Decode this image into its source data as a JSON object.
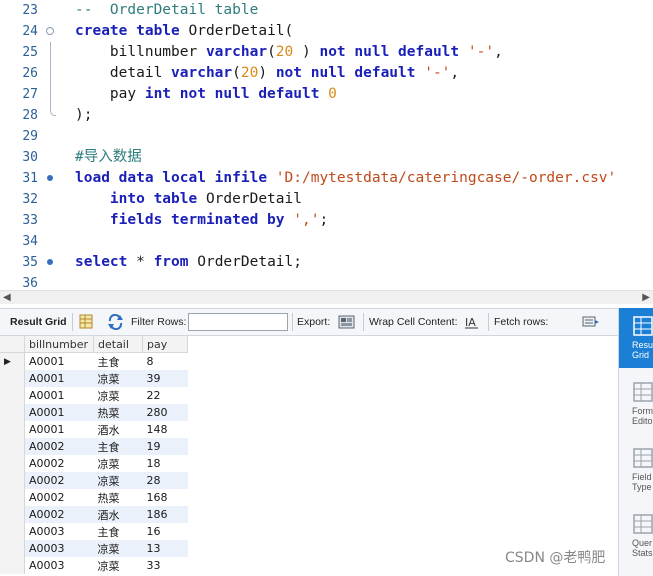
{
  "editor": {
    "lines": [
      {
        "n": "23",
        "parts": [
          [
            "cmt",
            "--  OrderDetail table"
          ]
        ]
      },
      {
        "n": "24",
        "fold": "start",
        "parts": [
          [
            "kw",
            "create table "
          ],
          [
            "",
            "OrderDetail("
          ]
        ]
      },
      {
        "n": "25",
        "fold": "mid",
        "parts": [
          [
            "",
            "    billnumber "
          ],
          [
            "kw",
            "varchar"
          ],
          [
            "",
            "("
          ],
          [
            "num",
            "20"
          ],
          [
            "",
            " ) "
          ],
          [
            "kw",
            "not null default "
          ],
          [
            "str",
            "'-'"
          ],
          [
            "",
            ","
          ]
        ]
      },
      {
        "n": "26",
        "fold": "mid",
        "parts": [
          [
            "",
            "    detail "
          ],
          [
            "kw",
            "varchar"
          ],
          [
            "",
            "("
          ],
          [
            "num",
            "20"
          ],
          [
            "",
            ") "
          ],
          [
            "kw",
            "not null default "
          ],
          [
            "str",
            "'-'"
          ],
          [
            "",
            ","
          ]
        ]
      },
      {
        "n": "27",
        "fold": "mid",
        "parts": [
          [
            "",
            "    pay "
          ],
          [
            "kw",
            "int not null default "
          ],
          [
            "num",
            "0"
          ]
        ]
      },
      {
        "n": "28",
        "fold": "end",
        "parts": [
          [
            "",
            ");"
          ]
        ]
      },
      {
        "n": "29",
        "parts": []
      },
      {
        "n": "30",
        "parts": [
          [
            "cmt",
            "#导入数据"
          ]
        ]
      },
      {
        "n": "31",
        "fold": "dot",
        "parts": [
          [
            "kw",
            "load data local infile "
          ],
          [
            "str",
            "'D:/mytestdata/cateringcase/-order.csv'"
          ]
        ]
      },
      {
        "n": "32",
        "parts": [
          [
            "",
            "    "
          ],
          [
            "kw",
            "into table "
          ],
          [
            "",
            "OrderDetail"
          ]
        ]
      },
      {
        "n": "33",
        "parts": [
          [
            "",
            "    "
          ],
          [
            "kw",
            "fields terminated by "
          ],
          [
            "str",
            "','"
          ],
          [
            "",
            ";"
          ]
        ]
      },
      {
        "n": "34",
        "parts": []
      },
      {
        "n": "35",
        "fold": "dot",
        "parts": [
          [
            "kw",
            "select "
          ],
          [
            "",
            "* "
          ],
          [
            "kw",
            "from "
          ],
          [
            "",
            "OrderDetail;"
          ]
        ]
      },
      {
        "n": "36",
        "parts": []
      }
    ]
  },
  "toolbar": {
    "result_grid": "Result Grid",
    "filter_rows": "Filter Rows:",
    "filter_value": "",
    "export": "Export:",
    "wrap": "Wrap Cell Content:",
    "fetch": "Fetch rows:"
  },
  "grid": {
    "columns": [
      "billnumber",
      "detail",
      "pay"
    ],
    "rows": [
      [
        "A0001",
        "主食",
        "8"
      ],
      [
        "A0001",
        "凉菜",
        "39"
      ],
      [
        "A0001",
        "凉菜",
        "22"
      ],
      [
        "A0001",
        "热菜",
        "280"
      ],
      [
        "A0001",
        "酒水",
        "148"
      ],
      [
        "A0002",
        "主食",
        "19"
      ],
      [
        "A0002",
        "凉菜",
        "18"
      ],
      [
        "A0002",
        "凉菜",
        "28"
      ],
      [
        "A0002",
        "热菜",
        "168"
      ],
      [
        "A0002",
        "酒水",
        "186"
      ],
      [
        "A0003",
        "主食",
        "16"
      ],
      [
        "A0003",
        "凉菜",
        "13"
      ],
      [
        "A0003",
        "凉菜",
        "33"
      ]
    ]
  },
  "sidepanel": {
    "items": [
      {
        "label": "Resul\nGrid",
        "icon": "result-grid-icon"
      },
      {
        "label": "Form\nEdito",
        "icon": "form-editor-icon"
      },
      {
        "label": "Field\nType",
        "icon": "field-types-icon"
      },
      {
        "label": "Quer\nStats",
        "icon": "query-stats-icon"
      }
    ]
  },
  "watermark": "CSDN @老鸭肥"
}
